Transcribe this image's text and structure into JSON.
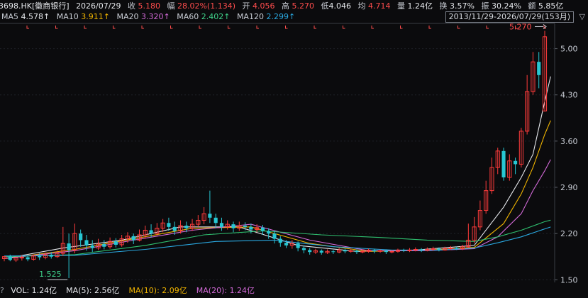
{
  "header": {
    "code": "3698.HK[徽商银行]",
    "date": "2026/07/29",
    "close_label": "收",
    "close": "5.180",
    "change_label": "幅",
    "change": "28.02%(1.134)",
    "open_label": "开",
    "open": "4.056",
    "high_label": "高",
    "high": "5.270",
    "low_label": "低",
    "low": "4.046",
    "avg_label": "均",
    "avg": "4.714",
    "vol_label": "量",
    "vol": "1.24亿",
    "turn_label": "换",
    "turn": "3.57%",
    "amp_label": "振",
    "amp": "30.24%",
    "amt_label": "额",
    "amt": "5.85亿"
  },
  "ma_line": [
    {
      "label": "MA5",
      "value": "4.578↑",
      "color": "#e6e8ec"
    },
    {
      "label": "MA10",
      "value": "3.911↑",
      "color": "#f0b400"
    },
    {
      "label": "MA20",
      "value": "3.320↑",
      "color": "#d36ad8"
    },
    {
      "label": "MA60",
      "value": "2.402↑",
      "color": "#3fd18a"
    },
    {
      "label": "MA120",
      "value": "2.299↑",
      "color": "#2aa8e0"
    }
  ],
  "range_label": "2013/11/29-2026/07/29(153月)",
  "range_arrow": "▽",
  "colors": {
    "up": "#ff3b3b",
    "down": "#27c7d3",
    "ma5": "#e6e8ec",
    "ma10": "#f0b400",
    "ma20": "#d36ad8",
    "ma60": "#2fbf6f",
    "ma120": "#2aa8e0"
  },
  "chart_data": {
    "type": "candlestick",
    "ylim": [
      1.46,
      5.35
    ],
    "y_ticks": [
      5.0,
      4.3,
      3.6,
      2.9,
      2.2,
      1.5
    ],
    "y_tick_labels": [
      "5.00",
      "4.30",
      "3.60",
      "2.90",
      "2.20",
      "1.50"
    ],
    "max_label": "5.270",
    "min_label": "1.525",
    "candles": [
      [
        1.82,
        1.85,
        1.78,
        1.86
      ],
      [
        1.85,
        1.8,
        1.78,
        1.88
      ],
      [
        1.8,
        1.83,
        1.77,
        1.85
      ],
      [
        1.83,
        1.84,
        1.79,
        1.87
      ],
      [
        1.84,
        1.81,
        1.78,
        1.86
      ],
      [
        1.81,
        1.86,
        1.79,
        1.88
      ],
      [
        1.86,
        1.84,
        1.8,
        1.9
      ],
      [
        1.84,
        1.88,
        1.81,
        1.91
      ],
      [
        1.88,
        1.85,
        1.82,
        1.92
      ],
      [
        1.85,
        1.9,
        1.83,
        1.94
      ],
      [
        1.9,
        2.05,
        1.86,
        2.3
      ],
      [
        2.05,
        1.95,
        1.525,
        2.2
      ],
      [
        1.95,
        2.2,
        1.9,
        2.35
      ],
      [
        2.2,
        2.1,
        2.0,
        2.26
      ],
      [
        2.1,
        2.02,
        1.94,
        2.18
      ],
      [
        2.02,
        1.98,
        1.92,
        2.1
      ],
      [
        1.98,
        2.04,
        1.95,
        2.12
      ],
      [
        2.04,
        2.0,
        1.96,
        2.1
      ],
      [
        2.0,
        2.08,
        1.97,
        2.14
      ],
      [
        2.08,
        2.03,
        1.99,
        2.13
      ],
      [
        2.03,
        2.12,
        2.0,
        2.18
      ],
      [
        2.12,
        2.16,
        2.06,
        2.22
      ],
      [
        2.16,
        2.1,
        2.04,
        2.2
      ],
      [
        2.1,
        2.18,
        2.08,
        2.26
      ],
      [
        2.18,
        2.25,
        2.12,
        2.32
      ],
      [
        2.25,
        2.2,
        2.14,
        2.34
      ],
      [
        2.2,
        2.28,
        2.17,
        2.36
      ],
      [
        2.28,
        2.36,
        2.22,
        2.42
      ],
      [
        2.36,
        2.3,
        2.24,
        2.44
      ],
      [
        2.3,
        2.24,
        2.18,
        2.38
      ],
      [
        2.24,
        2.32,
        2.2,
        2.4
      ],
      [
        2.32,
        2.28,
        2.22,
        2.38
      ],
      [
        2.28,
        2.34,
        2.24,
        2.42
      ],
      [
        2.34,
        2.4,
        2.3,
        2.48
      ],
      [
        2.4,
        2.5,
        2.34,
        2.6
      ],
      [
        2.5,
        2.44,
        2.36,
        2.85
      ],
      [
        2.44,
        2.36,
        2.28,
        2.5
      ],
      [
        2.36,
        2.3,
        2.24,
        2.44
      ],
      [
        2.3,
        2.34,
        2.26,
        2.4
      ],
      [
        2.34,
        2.28,
        2.22,
        2.38
      ],
      [
        2.28,
        2.32,
        2.24,
        2.38
      ],
      [
        2.32,
        2.3,
        2.25,
        2.37
      ],
      [
        2.3,
        2.26,
        2.2,
        2.35
      ],
      [
        2.26,
        2.29,
        2.22,
        2.34
      ],
      [
        2.29,
        2.24,
        2.18,
        2.33
      ],
      [
        2.24,
        2.2,
        2.12,
        2.28
      ],
      [
        2.2,
        2.12,
        2.05,
        2.25
      ],
      [
        2.12,
        2.06,
        2.0,
        2.16
      ],
      [
        2.06,
        2.02,
        1.98,
        2.1
      ],
      [
        2.02,
        2.05,
        1.97,
        2.1
      ],
      [
        2.05,
        1.98,
        1.93,
        2.08
      ],
      [
        1.98,
        1.95,
        1.9,
        2.02
      ],
      [
        1.95,
        1.92,
        1.88,
        1.98
      ],
      [
        1.92,
        1.94,
        1.89,
        1.97
      ],
      [
        1.94,
        1.91,
        1.88,
        1.96
      ],
      [
        1.91,
        1.93,
        1.89,
        1.96
      ],
      [
        1.93,
        1.92,
        1.89,
        1.95
      ],
      [
        1.92,
        1.95,
        1.9,
        1.98
      ],
      [
        1.95,
        1.93,
        1.9,
        1.97
      ],
      [
        1.93,
        1.94,
        1.91,
        1.97
      ],
      [
        1.94,
        1.92,
        1.89,
        1.96
      ],
      [
        1.92,
        1.93,
        1.9,
        1.96
      ],
      [
        1.93,
        1.95,
        1.91,
        1.97
      ],
      [
        1.95,
        1.93,
        1.9,
        1.97
      ],
      [
        1.93,
        1.94,
        1.91,
        1.96
      ],
      [
        1.94,
        1.92,
        1.89,
        1.96
      ],
      [
        1.92,
        1.93,
        1.9,
        1.95
      ],
      [
        1.93,
        1.95,
        1.91,
        1.97
      ],
      [
        1.95,
        1.94,
        1.92,
        1.97
      ],
      [
        1.94,
        1.95,
        1.92,
        1.98
      ],
      [
        1.95,
        1.96,
        1.93,
        1.99
      ],
      [
        1.96,
        1.94,
        1.92,
        1.98
      ],
      [
        1.94,
        1.96,
        1.93,
        1.99
      ],
      [
        1.96,
        1.97,
        1.94,
        2.0
      ],
      [
        1.97,
        1.95,
        1.93,
        1.99
      ],
      [
        1.95,
        1.97,
        1.94,
        2.0
      ],
      [
        1.97,
        1.98,
        1.95,
        2.01
      ],
      [
        1.98,
        1.97,
        1.95,
        2.0
      ],
      [
        1.97,
        2.0,
        1.95,
        2.03
      ],
      [
        2.0,
        2.1,
        1.98,
        2.35
      ],
      [
        2.1,
        2.3,
        2.05,
        2.45
      ],
      [
        2.3,
        2.55,
        2.25,
        2.7
      ],
      [
        2.55,
        2.85,
        2.5,
        3.0
      ],
      [
        2.85,
        3.2,
        2.8,
        3.35
      ],
      [
        3.2,
        3.45,
        3.1,
        3.5
      ],
      [
        3.45,
        3.05,
        3.0,
        3.5
      ],
      [
        3.05,
        3.3,
        3.0,
        3.4
      ],
      [
        3.3,
        3.25,
        3.1,
        3.35
      ],
      [
        3.25,
        3.75,
        3.2,
        3.8
      ],
      [
        3.75,
        4.35,
        3.7,
        4.6
      ],
      [
        4.35,
        4.8,
        4.3,
        4.95
      ],
      [
        4.8,
        4.6,
        4.4,
        4.95
      ],
      [
        4.056,
        5.18,
        4.046,
        5.27
      ]
    ],
    "ma_series": [
      {
        "name": "MA5",
        "color": "#e6e8ec",
        "x": [
          0,
          10,
          20,
          30,
          40,
          50,
          60,
          70,
          80,
          85,
          88,
          90,
          92,
          93
        ],
        "y": [
          1.82,
          1.98,
          2.1,
          2.3,
          2.3,
          2.02,
          1.93,
          1.95,
          2.02,
          2.6,
          3.05,
          3.4,
          4.2,
          4.578
        ]
      },
      {
        "name": "MA10",
        "color": "#f0b400",
        "x": [
          0,
          12,
          22,
          32,
          42,
          52,
          62,
          72,
          80,
          85,
          88,
          90,
          92,
          93
        ],
        "y": [
          1.82,
          1.96,
          2.12,
          2.28,
          2.3,
          2.05,
          1.93,
          1.95,
          1.99,
          2.35,
          2.8,
          3.2,
          3.7,
          3.911
        ]
      },
      {
        "name": "MA20",
        "color": "#d36ad8",
        "x": [
          0,
          12,
          22,
          32,
          42,
          52,
          62,
          72,
          80,
          84,
          88,
          90,
          92,
          93
        ],
        "y": [
          1.82,
          1.94,
          2.1,
          2.25,
          2.34,
          2.1,
          1.94,
          1.94,
          1.97,
          2.15,
          2.5,
          2.85,
          3.15,
          3.32
        ]
      },
      {
        "name": "MA60",
        "color": "#2fbf6f",
        "x": [
          0,
          12,
          24,
          34,
          44,
          54,
          64,
          72,
          80,
          84,
          88,
          92,
          93
        ],
        "y": [
          1.85,
          1.88,
          2.02,
          2.18,
          2.24,
          2.18,
          2.14,
          2.1,
          2.08,
          2.15,
          2.25,
          2.38,
          2.402
        ]
      },
      {
        "name": "MA120",
        "color": "#2aa8e0",
        "x": [
          0,
          12,
          24,
          36,
          46,
          56,
          66,
          74,
          80,
          84,
          88,
          92,
          93
        ],
        "y": [
          1.86,
          1.87,
          1.96,
          2.08,
          2.1,
          2.0,
          1.95,
          1.95,
          1.98,
          2.06,
          2.15,
          2.27,
          2.299
        ]
      }
    ]
  },
  "volume_bar": {
    "question": "?",
    "vol": "VOL: 1.24亿",
    "ma5": "MA(5): 2.56亿",
    "ma10": "MA(10): 2.09亿",
    "ma20": "MA(20): 1.24亿"
  }
}
